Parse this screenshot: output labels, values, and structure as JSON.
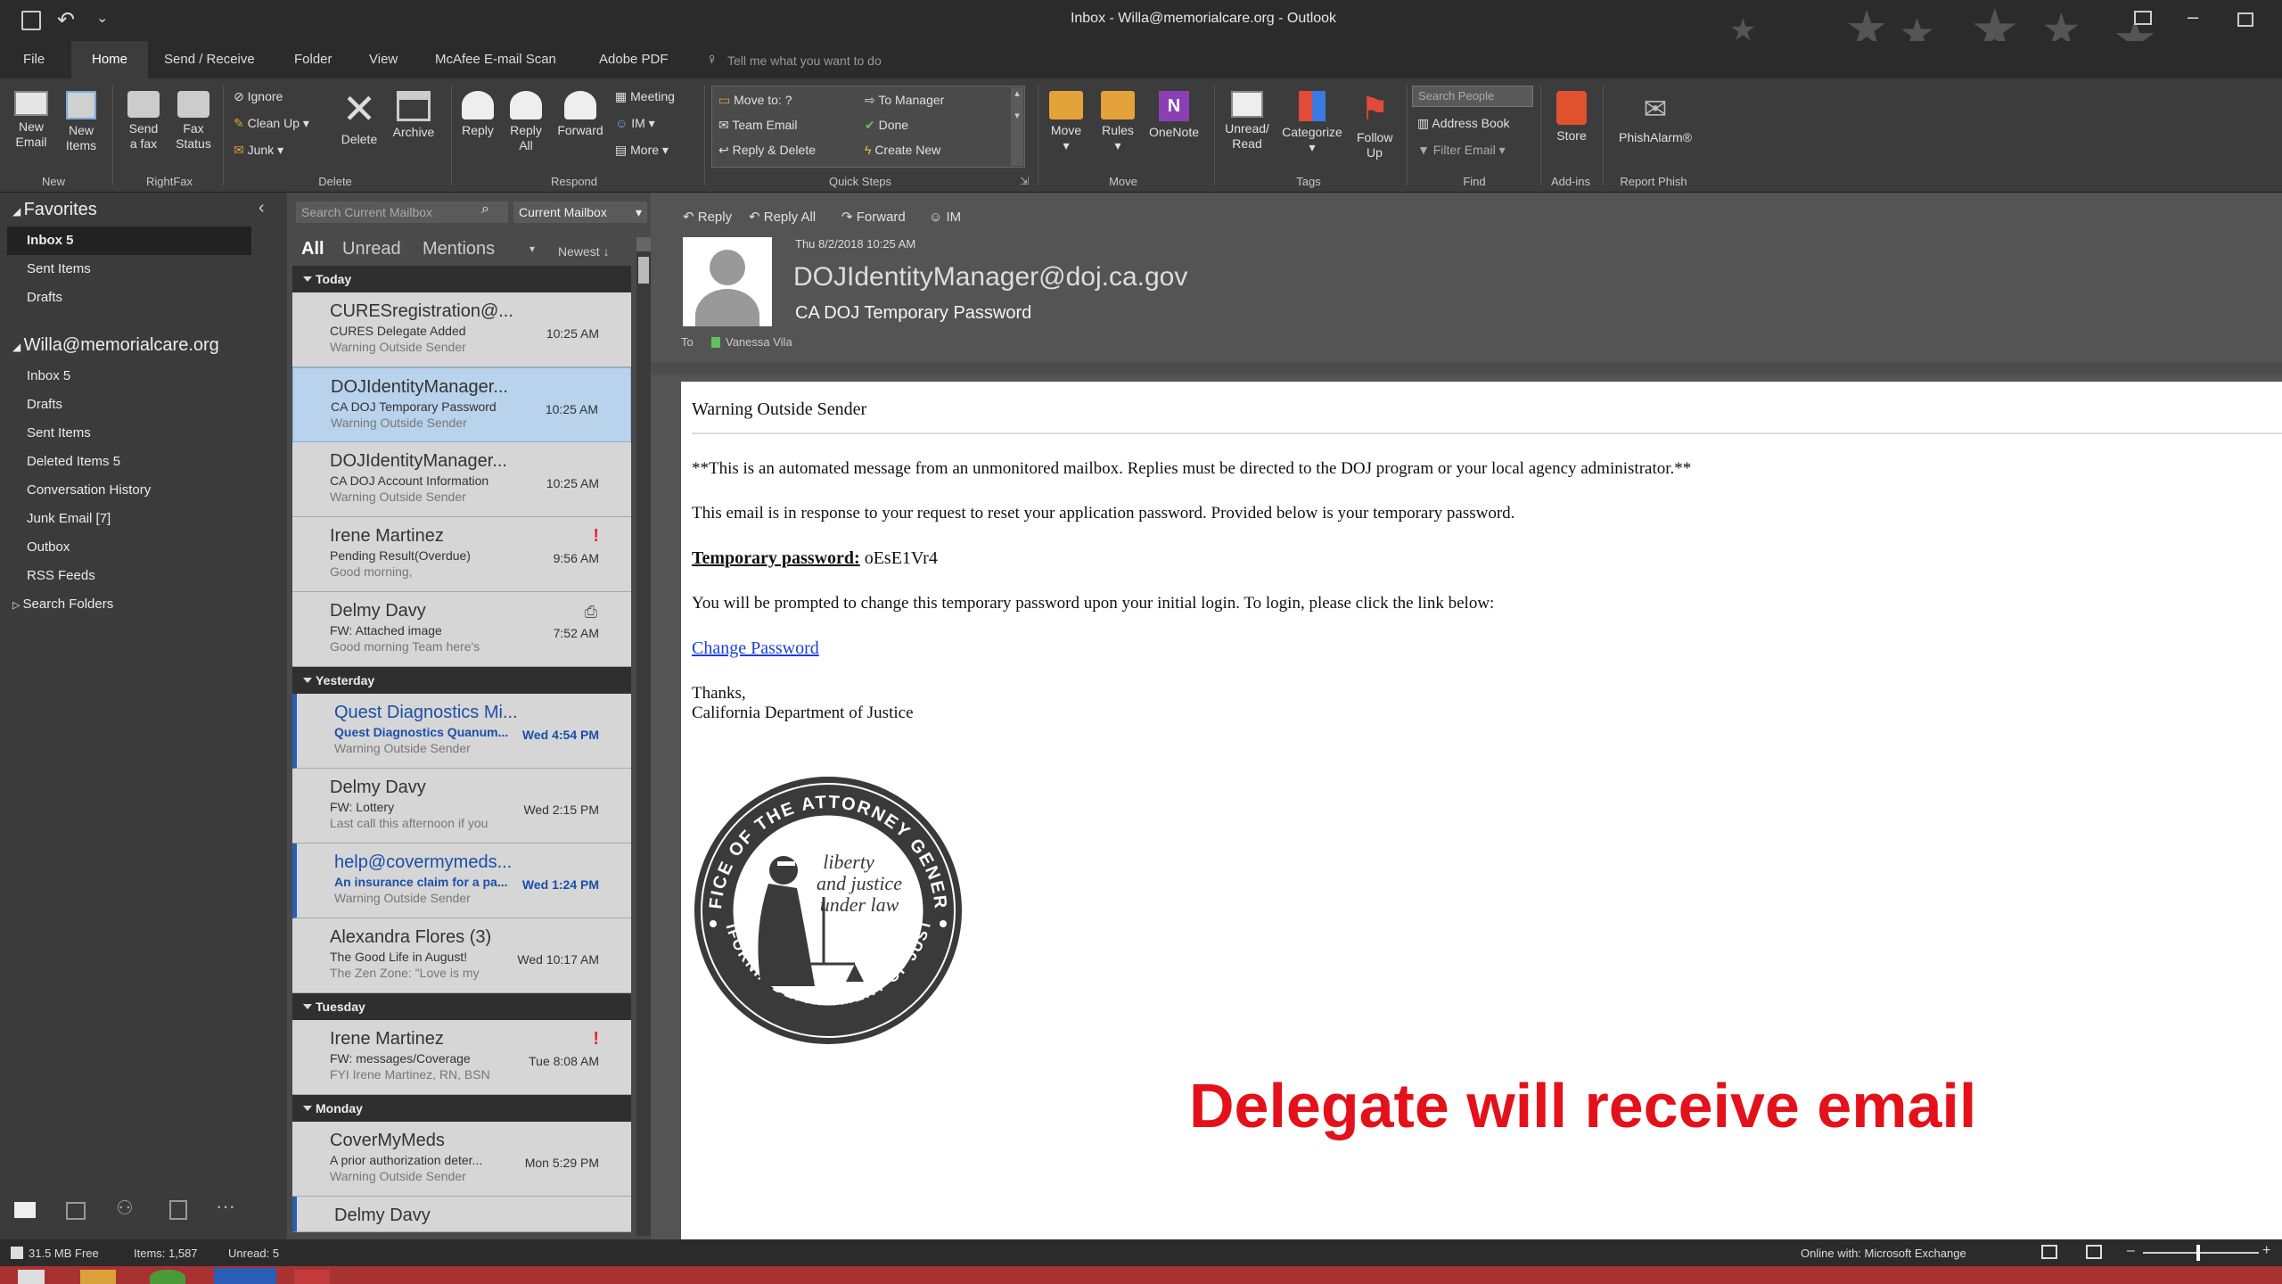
{
  "window": {
    "title": "Inbox - Willa@memorialcare.org - Outlook"
  },
  "tabs": [
    "File",
    "Home",
    "Send / Receive",
    "Folder",
    "View",
    "McAfee E-mail Scan",
    "Adobe PDF"
  ],
  "tell_me": "Tell me what you want to do",
  "ribbon": {
    "new_email": "New Email",
    "new_items": "New Items",
    "group_new": "New",
    "send_fax": "Send a fax",
    "fax_status": "Fax Status",
    "group_rightfax": "RightFax",
    "ignore": "Ignore",
    "clean_up": "Clean Up",
    "junk": "Junk",
    "delete": "Delete",
    "archive": "Archive",
    "group_delete": "Delete",
    "reply": "Reply",
    "reply_all": "Reply All",
    "forward": "Forward",
    "meeting": "Meeting",
    "im": "IM",
    "more": "More",
    "group_respond": "Respond",
    "qs_move_to": "Move to: ?",
    "qs_to_manager": "To Manager",
    "qs_team_email": "Team Email",
    "qs_done": "Done",
    "qs_reply_delete": "Reply & Delete",
    "qs_create_new": "Create New",
    "group_quick_steps": "Quick Steps",
    "move": "Move",
    "rules": "Rules",
    "onenote": "OneNote",
    "group_move": "Move",
    "unread_read": "Unread/ Read",
    "categorize": "Categorize",
    "follow_up": "Follow Up",
    "group_tags": "Tags",
    "search_people": "Search People",
    "address_book": "Address Book",
    "filter_email": "Filter Email",
    "group_find": "Find",
    "store": "Store",
    "group_addins": "Add-ins",
    "phishalarm": "PhishAlarm",
    "group_report": "Report Phish"
  },
  "nav": {
    "favorites": "Favorites",
    "fav_items": [
      {
        "label": "Inbox 5"
      },
      {
        "label": "Sent Items"
      },
      {
        "label": "Drafts"
      }
    ],
    "account": "Willa@memorialcare.org",
    "folders": [
      {
        "label": "Inbox 5"
      },
      {
        "label": "Drafts"
      },
      {
        "label": "Sent Items"
      },
      {
        "label": "Deleted Items 5"
      },
      {
        "label": "Conversation History"
      },
      {
        "label": "Junk Email [7]"
      },
      {
        "label": "Outbox"
      },
      {
        "label": "RSS Feeds"
      },
      {
        "label": "Search Folders"
      }
    ]
  },
  "list": {
    "search_placeholder": "Search Current Mailbox",
    "scope": "Current Mailbox",
    "filter_all": "All",
    "filter_unread": "Unread",
    "filter_mentions": "Mentions",
    "sort": "Newest",
    "groups": {
      "today": "Today",
      "yesterday": "Yesterday",
      "tuesday": "Tuesday",
      "monday": "Monday"
    },
    "messages": [
      {
        "from": "CURESregistration@...",
        "subject": "CURES Delegate Added",
        "preview": "Warning Outside Sender",
        "time": "10:25 AM"
      },
      {
        "from": "DOJIdentityManager...",
        "subject": "CA DOJ Temporary Password",
        "preview": "Warning Outside Sender",
        "time": "10:25 AM"
      },
      {
        "from": "DOJIdentityManager...",
        "subject": "CA DOJ Account Information",
        "preview": "Warning Outside Sender",
        "time": "10:25 AM"
      },
      {
        "from": "Irene Martinez",
        "subject": "Pending Result(Overdue)",
        "preview": "Good morning,",
        "time": "9:56 AM"
      },
      {
        "from": "Delmy Davy",
        "subject": "FW: Attached image",
        "preview": "Good morning Team here's",
        "time": "7:52 AM"
      },
      {
        "from": "Quest Diagnostics Mi...",
        "subject": "Quest Diagnostics Quanum...",
        "preview": "Warning Outside Sender",
        "time": "Wed 4:54 PM"
      },
      {
        "from": "Delmy Davy",
        "subject": "FW: Lottery",
        "preview": "Last call this afternoon if you",
        "time": "Wed 2:15 PM"
      },
      {
        "from": "help@covermymeds...",
        "subject": "An insurance claim for a pa...",
        "preview": "Warning Outside Sender",
        "time": "Wed 1:24 PM"
      },
      {
        "from": "Alexandra Flores (3)",
        "subject": "The Good Life in August!",
        "preview": "The Zen Zone: \"Love is my",
        "time": "Wed 10:17 AM"
      },
      {
        "from": "Irene Martinez",
        "subject": "FW: messages/Coverage",
        "preview": "FYI Irene Martinez, RN, BSN",
        "time": "Tue 8:08 AM"
      },
      {
        "from": "CoverMyMeds",
        "subject": "A prior authorization deter...",
        "preview": "Warning Outside Sender",
        "time": "Mon 5:29 PM"
      },
      {
        "from": "Delmy Davy",
        "subject": "",
        "preview": "",
        "time": ""
      }
    ]
  },
  "reading": {
    "actions": {
      "reply": "Reply",
      "reply_all": "Reply All",
      "forward": "Forward",
      "im": "IM"
    },
    "date": "Thu 8/2/2018 10:25 AM",
    "sender": "DOJIdentityManager@doj.ca.gov",
    "subject": "CA DOJ Temporary Password",
    "to_label": "To",
    "to_name": "Vanessa Vila",
    "body": {
      "warning": "Warning Outside Sender",
      "auto": "**This is an automated message from an unmonitored mailbox. Replies must be directed to the DOJ program or your local agency administrator.**",
      "intro": "This email is in response to your request to reset your application password. Provided below is your temporary password.",
      "pw_label": "Temporary password:",
      "pw_value": "oEsE1Vr4",
      "prompt": "You will be prompted to change this temporary password upon your initial login. To login, please click the link below:",
      "link": "Change Password",
      "thanks": "Thanks,",
      "sig": "California Department of Justice"
    },
    "seal": {
      "ring_top": "OFFICE OF THE ATTORNEY GENERAL",
      "ring_bottom": "CALIFORNIA DEPARTMENT OF JUSTICE",
      "motto1": "liberty",
      "motto2": "and justice",
      "motto3": "under law"
    },
    "overlay": "Delegate will receive email"
  },
  "status": {
    "free": "31.5 MB Free",
    "items": "Items: 1,587",
    "unread": "Unread: 5",
    "online": "Online with: Microsoft Exchange"
  }
}
